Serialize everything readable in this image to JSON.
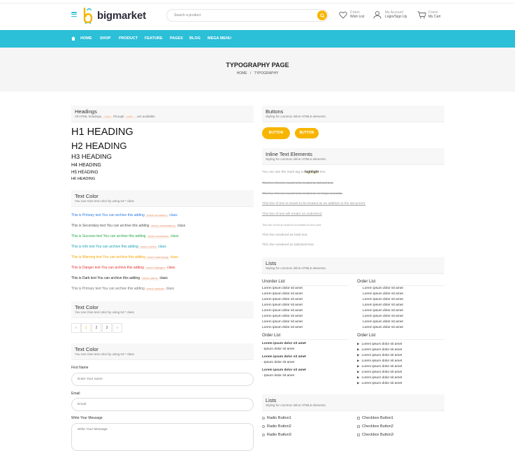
{
  "header": {
    "logo": "bigmarket",
    "search_placeholder": "Search a product",
    "wishlist": {
      "count": "0 item",
      "label": "Wish List"
    },
    "account": {
      "top": "My Account",
      "label": "Login/Sign Up"
    },
    "cart": {
      "count": "0 item",
      "label": "My Cart"
    }
  },
  "nav": [
    "HOME",
    "SHOP",
    "PRODUCT",
    "FEATURE",
    "PAGES",
    "BLOG",
    "MEGA MENU"
  ],
  "page": {
    "title": "TYPOGRAPHY PAGE",
    "crumb_home": "HOME",
    "crumb_sep": "/",
    "crumb_current": "TYPOGRAPHY"
  },
  "headings": {
    "title": "Headings",
    "sub_pre": "All HTML headings,",
    "sub_code1": "<h1>",
    "sub_mid": "through",
    "sub_code2": "<h6>",
    "sub_post": ", are available.",
    "h1": "H1 HEADING",
    "h2": "H2 HEADING",
    "h3": "H3 HEADING",
    "h4": "H4 HEADING",
    "h5": "H5 HEADING",
    "h6": "H6 HEADING"
  },
  "text_color": {
    "title": "Text Color",
    "sub": "You can Give text color by using txt-* class",
    "lines": [
      {
        "text": "This is Primary text You can archive this adding",
        "code": "text-primary",
        "suffix": "class",
        "color": "#2a7be4"
      },
      {
        "text": "This is Secondary text You can archive this adding",
        "code": "text-secondary",
        "suffix": "class",
        "color": "#555555"
      },
      {
        "text": "This is Success text You can archive this adding",
        "code": "text-success",
        "suffix": "class",
        "color": "#28a745"
      },
      {
        "text": "This is Info text You can archive this adding",
        "code": "text-info",
        "suffix": "class",
        "color": "#17a2b8"
      },
      {
        "text": "This is Warning text You can archive this adding",
        "code": "text-warning",
        "suffix": "class",
        "color": "#f7a500"
      },
      {
        "text": "This is Danger text You can archive this adding",
        "code": "text-danger",
        "suffix": "class",
        "color": "#e3342f"
      },
      {
        "text": "This is Dark text You can archive this adding",
        "code": "text-dark",
        "suffix": "class",
        "color": "#222222"
      },
      {
        "text": "This is Primary text You can archive this adding",
        "code": "text-muted",
        "suffix": "class",
        "color": "#777777"
      }
    ]
  },
  "pagination_box": {
    "title": "Text Color",
    "sub": "You can Give text color by using txt-* class",
    "prev": "‹",
    "pages": [
      "1",
      "2",
      "3"
    ],
    "next": "›"
  },
  "form_box": {
    "title": "Text Color",
    "sub": "You can Give text color by using txt-* class",
    "first_name_label": "First Name",
    "first_name_ph": "Enter Your name",
    "email_label": "Email",
    "email_ph": "Email",
    "message_label": "Write Your Message",
    "message_ph": "Write Your Message"
  },
  "buttons": {
    "title": "Buttons",
    "sub": "Styling for common inline HTML5 elements.",
    "btn1": "BUTTON",
    "btn2": "BUTTON"
  },
  "inline": {
    "title": "Inline Text Elements",
    "sub": "Styling for common inline HTML5 elements.",
    "mark_pre": "You can use the mark tag to",
    "mark_word": "highlight",
    "mark_post": "text.",
    "del": "This line of text is meant to be treated as deleted text.",
    "s": "This line of text is meant to be treated as no longer accurate.",
    "ins": "This line of text is meant to be treated as an addition to the document.",
    "u": "This line of text will render as underlined",
    "small": "This line of text is meant to be treated as fine print.",
    "strong": "This line rendered as bold text.",
    "em": "This line rendered as italicized text."
  },
  "lists": {
    "title": "Lists",
    "sub": "Styling for common inline HTML5 elements.",
    "unorder_title": "Unorder List",
    "order_title": "Order List",
    "item": "Lorem ipsum dolor sit amet",
    "order2_title": "Order List",
    "order2_sub": "- Ipsum dolor sit amet",
    "order3_title": "Order List"
  },
  "lists2": {
    "title": "Lists",
    "sub": "Styling for common inline HTML5 elements.",
    "radios": [
      "Radio Button1",
      "Radio Button2",
      "Radio Button3"
    ],
    "checks": [
      "Checkbox Button1",
      "Checkbox Button2",
      "Checkbox Button3"
    ]
  },
  "colors": {
    "accent": "#2bbfd8",
    "button": "#f7b500"
  }
}
